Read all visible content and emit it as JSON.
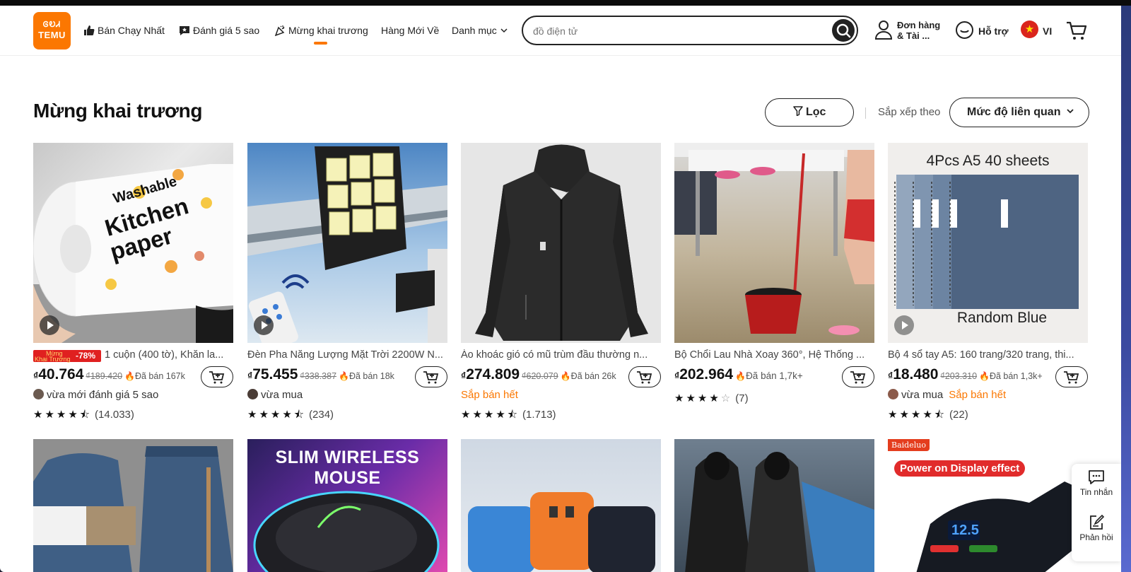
{
  "header": {
    "logo_text_top": "ᎶᎧᏗ",
    "logo_text": "TEMU",
    "nav": [
      {
        "label": "Bán Chạy Nhất",
        "icon": "thumbs-up-icon"
      },
      {
        "label": "Đánh giá 5 sao",
        "icon": "star-chat-icon"
      },
      {
        "label": "Mừng khai trương",
        "icon": "party-icon"
      },
      {
        "label": "Hàng Mới Về",
        "icon": ""
      },
      {
        "label": "Danh mục",
        "icon": "chevron-down-icon"
      }
    ],
    "search_placeholder": "đồ điện tử",
    "account_line1": "Đơn hàng",
    "account_line2": "& Tài ...",
    "support": "Hỗ trợ",
    "language": "VI",
    "accent_color": "#fb7701"
  },
  "main": {
    "title": "Mừng khai trương",
    "filter_label": "Lọc",
    "sort_label": "Sắp xếp theo",
    "sort_value": "Mức độ liên quan"
  },
  "products": [
    {
      "title": "1 cuộn (400 tờ), Khăn la...",
      "badge_line1": "Mừng",
      "badge_line2": "Khai Trương",
      "discount": "-78%",
      "currency": "₫",
      "price": "40.764",
      "old_price": "₫189.420",
      "sold": "Đã bán 167k",
      "activity": "vừa mới đánh giá 5 sao",
      "rating": 4.5,
      "reviews": "(14.033)",
      "image_text_1": "Washable",
      "image_text_2": "Kitchen",
      "image_text_3": "paper"
    },
    {
      "title": "Đèn Pha Năng Lượng Mặt Trời 2200W N...",
      "currency": "₫",
      "price": "75.455",
      "old_price": "₫338.387",
      "sold": "Đã bán 18k",
      "activity": "vừa mua",
      "rating": 4.5,
      "reviews": "(234)"
    },
    {
      "title": "Áo khoác gió có mũ trùm đầu thường n...",
      "currency": "₫",
      "price": "274.809",
      "old_price": "₫620.079",
      "sold": "Đã bán 26k",
      "hot": "Sắp bán hết",
      "rating": 4.5,
      "reviews": "(1.713)"
    },
    {
      "title": "Bộ Chổi Lau Nhà Xoay 360°, Hệ Thống ...",
      "currency": "₫",
      "price": "202.964",
      "sold": "Đã bán 1,7k+",
      "rating": 4,
      "reviews": "(7)"
    },
    {
      "title": "Bộ 4 sổ tay A5: 160 trang/320 trang, thi...",
      "currency": "₫",
      "price": "18.480",
      "old_price": "₫203.310",
      "sold": "Đã bán 1,3k+",
      "activity": "vừa mua",
      "hot": "Sắp bán hết",
      "rating": 4.5,
      "reviews": "(22)",
      "image_text_1": "4Pcs A5 40 sheets",
      "image_text_2": "Random Blue"
    }
  ],
  "row2": {
    "mouse_text": "SLIM WIRELESS MOUSE",
    "brand_tag": "Baideluo",
    "charger_text": "Power on Display effect",
    "charger_display": "12.5"
  },
  "float_panel": {
    "messages": "Tin nhắn",
    "feedback": "Phản hồi"
  }
}
